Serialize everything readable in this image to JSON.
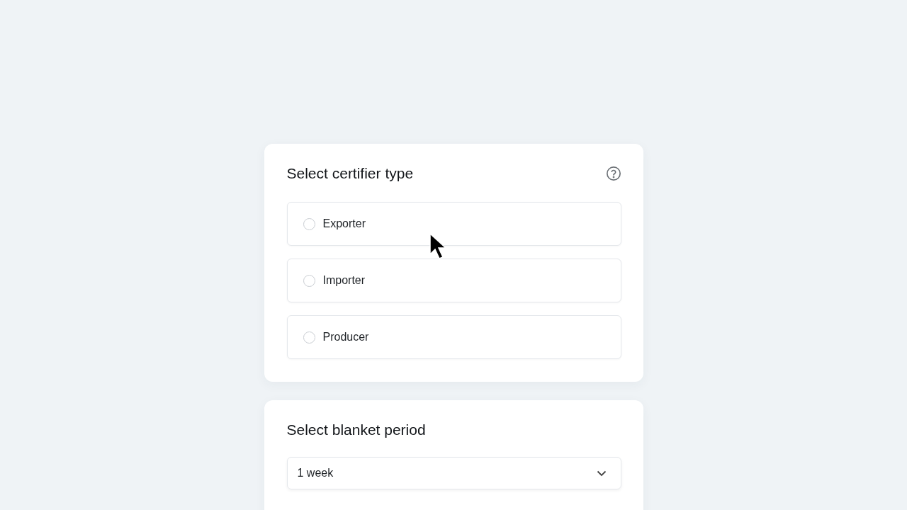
{
  "certifier_card": {
    "title": "Select certifier type",
    "options": [
      {
        "label": "Exporter",
        "selected": false
      },
      {
        "label": "Importer",
        "selected": false
      },
      {
        "label": "Producer",
        "selected": false
      }
    ]
  },
  "period_card": {
    "title": "Select blanket period",
    "select": {
      "value": "1 week"
    }
  }
}
